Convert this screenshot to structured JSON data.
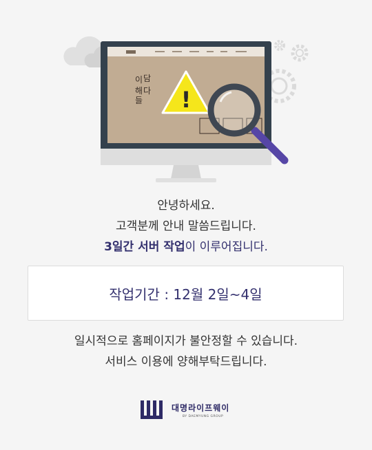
{
  "illustration": {
    "screen_title_chars": [
      "이",
      "담",
      "해",
      "다",
      "들"
    ],
    "warning_symbol": "!",
    "icons": [
      "cloud-icon",
      "gear-icon",
      "monitor-icon",
      "warning-icon",
      "magnifier-icon"
    ]
  },
  "message": {
    "line1": "안녕하세요.",
    "line2": "고객분께 안내 말씀드립니다.",
    "line3_accent": "3일간 서버 작업",
    "line3_rest": "이 이루어집니다."
  },
  "period": {
    "label": "작업기간 : 12월 2일~4일"
  },
  "notice": {
    "line1": "일시적으로 홈페이지가 불안정할 수 있습니다.",
    "line2": "서비스 이용에 양해부탁드립니다."
  },
  "logo": {
    "name": "대명라이프웨이",
    "sub": "BY DAEMYUNG GROUP"
  },
  "colors": {
    "accent": "#33306e",
    "background": "#f5f5f5",
    "warning": "#f5e61b",
    "monitor": "#34414d"
  }
}
